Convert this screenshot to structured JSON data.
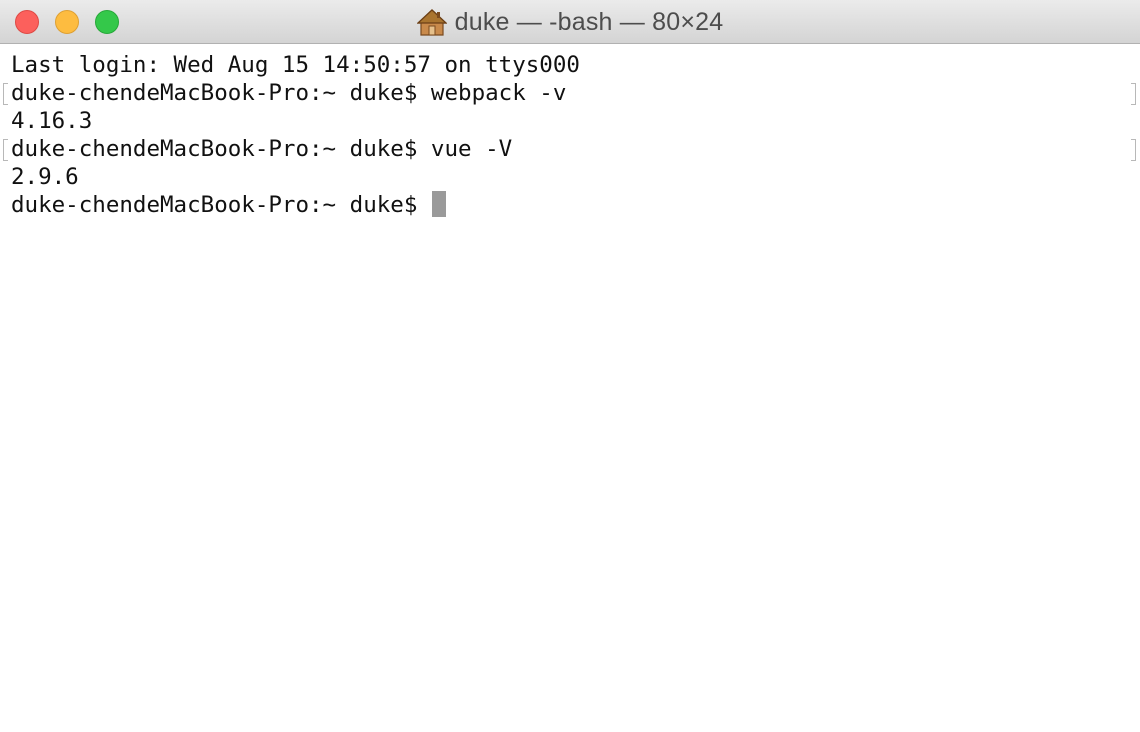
{
  "window": {
    "title": "duke — -bash — 80×24",
    "title_icon": "home-icon"
  },
  "traffic_lights": {
    "close_color": "#fc605c",
    "minimize_color": "#fdbc40",
    "zoom_color": "#34c84a"
  },
  "terminal": {
    "background": "#ffffff",
    "text_color": "#111111",
    "lines": [
      "Last login: Wed Aug 15 14:50:57 on ttys000",
      "duke-chendeMacBook-Pro:~ duke$ webpack -v",
      "4.16.3",
      "duke-chendeMacBook-Pro:~ duke$ vue -V",
      "2.9.6",
      "duke-chendeMacBook-Pro:~ duke$ "
    ],
    "marked_lines": [
      1,
      3
    ],
    "cursor_line": 5
  }
}
